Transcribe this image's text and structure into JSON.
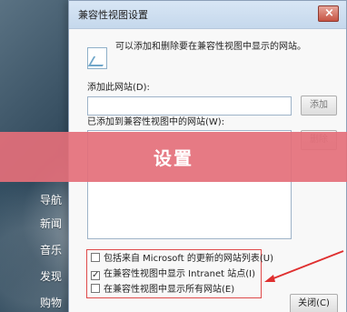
{
  "navigation": {
    "items": [
      "导航",
      "新闻",
      "音乐",
      "发现",
      "购物"
    ]
  },
  "dialog": {
    "title": "兼容性视图设置",
    "description": "可以添加和删除要在兼容性视图中显示的网站。",
    "add_site_label": "添加此网站(D):",
    "add_site_value": "",
    "add_button": "添加",
    "added_sites_label": "已添加到兼容性视图中的网站(W):",
    "remove_button": "删除",
    "options": [
      {
        "label": "包括来自 Microsoft 的更新的网站列表(U)",
        "checked": false
      },
      {
        "label": "在兼容性视图中显示 Intranet 站点(I)",
        "checked": true
      },
      {
        "label": "在兼容性视图中显示所有网站(E)",
        "checked": false
      }
    ],
    "close_button": "关闭(C)"
  },
  "overlay": {
    "banner_text": "设置"
  },
  "icons": {
    "window": "window-icon",
    "picture": "picture-icon",
    "close": "close-icon"
  },
  "colors": {
    "dialog_background": "#f0f0f0",
    "highlight_border": "#df4b4b",
    "banner": "#e46f7a"
  }
}
